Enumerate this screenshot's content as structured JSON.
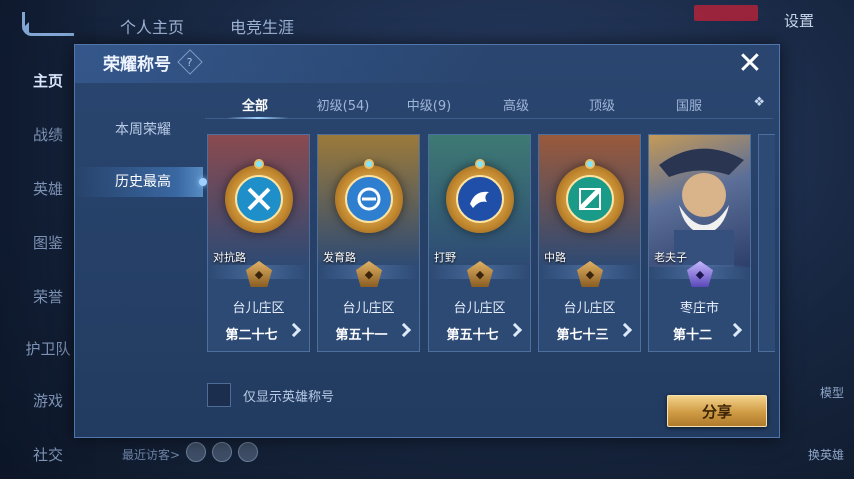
{
  "background": {
    "top_tabs": [
      "个人主页",
      "电竞生涯"
    ],
    "settings_label": "设置",
    "left_menu": [
      "主页",
      "战绩",
      "英雄",
      "图鉴",
      "荣誉",
      "护卫队",
      "游戏",
      "社交"
    ],
    "right_labels": [
      "模型",
      "换英雄"
    ],
    "visitors_label": "最近访客>"
  },
  "dialog": {
    "title": "荣耀称号",
    "help_icon": "?",
    "close_icon": "✕",
    "side_tabs": [
      {
        "label": "本周荣耀",
        "active": false
      },
      {
        "label": "历史最高",
        "active": true
      }
    ],
    "tabs": [
      {
        "label": "全部",
        "active": true
      },
      {
        "label": "初级(54)",
        "active": false
      },
      {
        "label": "中级(9)",
        "active": false
      },
      {
        "label": "高级",
        "active": false
      },
      {
        "label": "顶级",
        "active": false
      },
      {
        "label": "国服",
        "active": false
      }
    ],
    "tab_more_icon": "❖",
    "cards": [
      {
        "label": "对抗路",
        "region": "台儿庄区",
        "rank": "第二十七",
        "color": "#8a4a4f"
      },
      {
        "label": "发育路",
        "region": "台儿庄区",
        "rank": "第五十一",
        "color": "#9b7a3a"
      },
      {
        "label": "打野",
        "region": "台儿庄区",
        "rank": "第五十七",
        "color": "#3e7a74"
      },
      {
        "label": "中路",
        "region": "台儿庄区",
        "rank": "第七十三",
        "color": "#9a5a3c"
      },
      {
        "label": "老夫子",
        "region": "枣庄市",
        "rank": "第十二",
        "color": "#5a6fa0"
      }
    ],
    "checkbox_label": "仅显示英雄称号",
    "share_label": "分享"
  }
}
